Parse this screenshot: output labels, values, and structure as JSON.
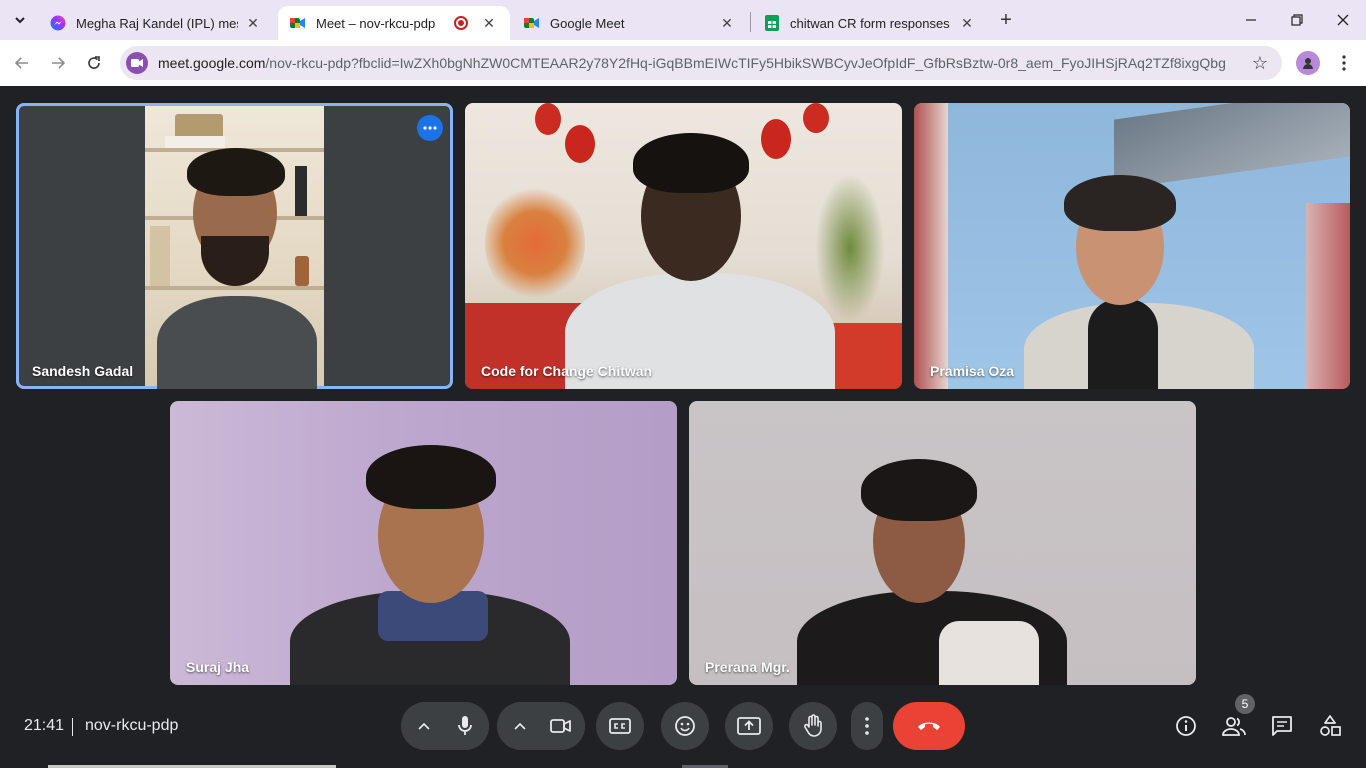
{
  "browser": {
    "tabs": [
      {
        "title": "Megha Raj Kandel (IPL) messag",
        "favicon": "messenger-icon",
        "active": false
      },
      {
        "title": "Meet – nov-rkcu-pdp",
        "favicon": "google-meet-icon",
        "active": true,
        "recording": true
      },
      {
        "title": "Google Meet",
        "favicon": "google-meet-icon",
        "active": false
      },
      {
        "title": "chitwan CR form responses - Go",
        "favicon": "google-sheets-icon",
        "active": false
      }
    ],
    "url_host": "meet.google.com",
    "url_path": "/nov-rkcu-pdp?fbclid=IwZXh0bgNhZW0CMTEAAR2y78Y2fHq-iGqBBmEIWcTIFy5HbikSWBCyvJeOfpIdF_GfbRsBztw-0r8_aem_FyoJIHSjRAq2TZf8ixgQbg"
  },
  "meet": {
    "participants": [
      {
        "name": "Sandesh Gadal",
        "active_speaker": true
      },
      {
        "name": "Code for Change Chitwan",
        "active_speaker": false
      },
      {
        "name": "Pramisa Oza",
        "active_speaker": false
      },
      {
        "name": "Suraj Jha",
        "active_speaker": false
      },
      {
        "name": "Prerana Mgr.",
        "active_speaker": false
      }
    ],
    "time": "21:41",
    "meeting_code": "nov-rkcu-pdp",
    "people_count": "5"
  },
  "colors": {
    "end_call": "#ea4335",
    "active_outline": "#8ab4f8",
    "more_button": "#1a73e8"
  }
}
